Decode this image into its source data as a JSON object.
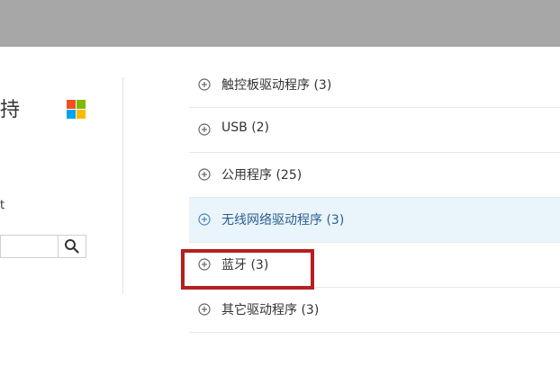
{
  "left_panel": {
    "title": "持",
    "label": "t",
    "search": {
      "value": "",
      "placeholder": ""
    }
  },
  "drivers": [
    {
      "label": "触控板驱动程序 (3)"
    },
    {
      "label": "USB (2)"
    },
    {
      "label": "公用程序 (25)"
    },
    {
      "label": "无线网络驱动程序 (3)"
    },
    {
      "label": "蓝牙 (3)"
    },
    {
      "label": "其它驱动程序 (3)"
    }
  ],
  "colors": {
    "top_band": "#a7a7a7",
    "highlight_row": "#eaf4fb",
    "callout_border": "#b61f1f",
    "ms_red": "#f25022",
    "ms_green": "#7fba00",
    "ms_blue": "#00a4ef",
    "ms_yellow": "#ffb900"
  },
  "icons": {
    "logo": "microsoft-logo",
    "search": "search-icon",
    "expand": "plus-circle-icon"
  }
}
